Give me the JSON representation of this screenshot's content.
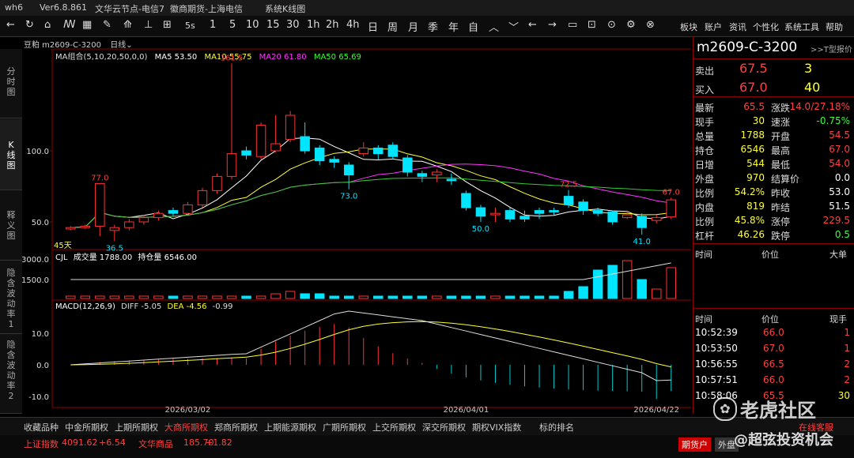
{
  "titlebar": {
    "app": "wh6",
    "version": "Ver6.8.861",
    "node": "文华云节点-电信7",
    "broker": "徽商期货-上海电信",
    "window": "系统K线图"
  },
  "toolbar": {
    "periods": [
      "1",
      "5",
      "10",
      "15",
      "30",
      "1h",
      "2h",
      "4h",
      "日",
      "周",
      "月",
      "季",
      "年",
      "自"
    ],
    "ss_label": "5s",
    "right_menu": [
      "板块",
      "账户",
      "资讯",
      "个性化",
      "系统工具",
      "帮助"
    ]
  },
  "left_tabs": [
    "分时图",
    "K线图",
    "释义图",
    "隐含波动率1",
    "隐含波动率2"
  ],
  "chart_header": {
    "symbol": "豆粕 m2609-C-3200",
    "period": "日线",
    "ma_group": "MA组合(5,10,20,50,0,0)",
    "ma5": "MA5 53.50",
    "ma10": "MA10 55.75",
    "ma20": "MA20 61.80",
    "ma50": "MA50 65.69",
    "vol_label": "CJL",
    "vol_value": "成交量 1788.00",
    "oi_value": "持仓量 6546.00",
    "macd_label": "MACD(12,26,9)",
    "diff": "DIFF -5.05",
    "dea": "DEA -4.56",
    "macd_val": "-0.99",
    "days": "45天"
  },
  "chart_data": {
    "type": "candlestick",
    "y_axis_ticks": [
      "100.0",
      "50.0"
    ],
    "vol_ticks": [
      "3000.0",
      "1500.0"
    ],
    "macd_ticks": [
      "10.0",
      "0.0",
      "-10.0"
    ],
    "x_ticks": [
      "2026/03/02",
      "2026/04/01",
      "2026/04/22"
    ],
    "annotations": [
      "161.5",
      "77.0",
      "36.5",
      "73.0",
      "72.5",
      "50.0",
      "67.0",
      "41.0"
    ],
    "candles": [
      {
        "o": 45,
        "c": 46,
        "h": 47,
        "l": 44,
        "up": true
      },
      {
        "o": 46,
        "c": 47,
        "h": 48,
        "l": 45,
        "up": true
      },
      {
        "o": 47,
        "c": 77,
        "h": 77,
        "l": 40,
        "up": true
      },
      {
        "o": 44,
        "c": 46,
        "h": 48,
        "l": 36.5,
        "up": true
      },
      {
        "o": 46,
        "c": 50,
        "h": 52,
        "l": 44,
        "up": true
      },
      {
        "o": 50,
        "c": 53,
        "h": 55,
        "l": 48,
        "up": true
      },
      {
        "o": 53,
        "c": 56,
        "h": 58,
        "l": 51,
        "up": true
      },
      {
        "o": 58,
        "c": 56,
        "h": 60,
        "l": 54,
        "up": false
      },
      {
        "o": 56,
        "c": 62,
        "h": 64,
        "l": 55,
        "up": true
      },
      {
        "o": 62,
        "c": 72,
        "h": 74,
        "l": 60,
        "up": true
      },
      {
        "o": 72,
        "c": 82,
        "h": 84,
        "l": 70,
        "up": true
      },
      {
        "o": 82,
        "c": 98,
        "h": 161.5,
        "l": 80,
        "up": true
      },
      {
        "o": 100,
        "c": 97,
        "h": 103,
        "l": 94,
        "up": false
      },
      {
        "o": 96,
        "c": 118,
        "h": 120,
        "l": 94,
        "up": true
      },
      {
        "o": 100,
        "c": 105,
        "h": 125,
        "l": 99,
        "up": true
      },
      {
        "o": 108,
        "c": 125,
        "h": 128,
        "l": 106,
        "up": true
      },
      {
        "o": 110,
        "c": 100,
        "h": 120,
        "l": 98,
        "up": false
      },
      {
        "o": 102,
        "c": 93,
        "h": 104,
        "l": 90,
        "up": false
      },
      {
        "o": 94,
        "c": 92,
        "h": 96,
        "l": 88,
        "up": false
      },
      {
        "o": 90,
        "c": 83,
        "h": 92,
        "l": 73,
        "up": false
      },
      {
        "o": 98,
        "c": 102,
        "h": 106,
        "l": 96,
        "up": true
      },
      {
        "o": 102,
        "c": 98,
        "h": 104,
        "l": 94,
        "up": false
      },
      {
        "o": 104,
        "c": 96,
        "h": 106,
        "l": 94,
        "up": false
      },
      {
        "o": 95,
        "c": 85,
        "h": 97,
        "l": 82,
        "up": false
      },
      {
        "o": 84,
        "c": 82,
        "h": 86,
        "l": 78,
        "up": false
      },
      {
        "o": 83,
        "c": 85,
        "h": 87,
        "l": 78,
        "up": true
      },
      {
        "o": 80,
        "c": 79,
        "h": 84,
        "l": 76,
        "up": false
      },
      {
        "o": 70,
        "c": 60,
        "h": 72,
        "l": 58,
        "up": false
      },
      {
        "o": 60,
        "c": 54,
        "h": 62,
        "l": 50,
        "up": false
      },
      {
        "o": 55,
        "c": 56,
        "h": 60,
        "l": 50,
        "up": true
      },
      {
        "o": 58,
        "c": 52,
        "h": 60,
        "l": 50,
        "up": false
      },
      {
        "o": 54,
        "c": 52,
        "h": 58,
        "l": 50,
        "up": false
      },
      {
        "o": 58,
        "c": 56,
        "h": 60,
        "l": 52,
        "up": false
      },
      {
        "o": 58,
        "c": 57,
        "h": 60,
        "l": 55,
        "up": false
      },
      {
        "o": 62,
        "c": 68,
        "h": 72.5,
        "l": 60,
        "up": false
      },
      {
        "o": 64,
        "c": 58,
        "h": 66,
        "l": 55,
        "up": false
      },
      {
        "o": 58,
        "c": 56,
        "h": 60,
        "l": 54,
        "up": false
      },
      {
        "o": 57,
        "c": 50,
        "h": 58,
        "l": 48,
        "up": false
      },
      {
        "o": 53,
        "c": 55,
        "h": 58,
        "l": 52,
        "up": true
      },
      {
        "o": 54,
        "c": 46,
        "h": 56,
        "l": 41,
        "up": false
      },
      {
        "o": 51,
        "c": 53,
        "h": 55,
        "l": 49,
        "up": true
      },
      {
        "o": 53.5,
        "c": 65.5,
        "h": 67,
        "l": 52,
        "up": true
      }
    ],
    "volume": [
      0,
      0,
      0,
      0,
      0,
      0,
      0,
      0,
      0,
      0,
      0,
      0,
      0,
      0,
      0,
      0,
      0,
      0,
      0,
      0,
      0,
      0,
      0,
      0,
      0,
      0,
      0,
      0,
      0,
      0,
      0,
      0,
      0,
      0,
      0,
      0,
      0,
      0,
      0,
      0,
      0,
      0
    ],
    "ylim": [
      35,
      165
    ]
  },
  "quote": {
    "symbol": "m2609-C-3200",
    "t_quote": ">>T型报价",
    "sell_label": "卖出",
    "sell_price": "67.5",
    "sell_qty": "3",
    "buy_label": "买入",
    "buy_price": "67.0",
    "buy_qty": "40",
    "rows": [
      {
        "l1": "最新",
        "v1": "65.5",
        "c1": "red",
        "l2": "涨跌",
        "v2": "14.0/27.18%",
        "c2": "red"
      },
      {
        "l1": "现手",
        "v1": "30",
        "c1": "yellow",
        "l2": "速涨",
        "v2": "-0.75%",
        "c2": "green"
      },
      {
        "l1": "总量",
        "v1": "1788",
        "c1": "yellow",
        "l2": "开盘",
        "v2": "54.5",
        "c2": "red"
      },
      {
        "l1": "持仓",
        "v1": "6546",
        "c1": "yellow",
        "l2": "最高",
        "v2": "67.0",
        "c2": "red"
      },
      {
        "l1": "日增",
        "v1": "544",
        "c1": "yellow",
        "l2": "最低",
        "v2": "54.0",
        "c2": "red"
      },
      {
        "l1": "外盘",
        "v1": "970",
        "c1": "yellow",
        "l2": "结算价",
        "v2": "0.0",
        "c2": "white"
      },
      {
        "l1": "比例",
        "v1": "54.2%",
        "c1": "yellow",
        "l2": "昨收",
        "v2": "53.0",
        "c2": "white"
      },
      {
        "l1": "内盘",
        "v1": "819",
        "c1": "yellow",
        "l2": "昨结",
        "v2": "51.5",
        "c2": "white"
      },
      {
        "l1": "比例",
        "v1": "45.8%",
        "c1": "yellow",
        "l2": "涨停",
        "v2": "229.5",
        "c2": "red"
      },
      {
        "l1": "杠杆",
        "v1": "46.26",
        "c1": "yellow",
        "l2": "跌停",
        "v2": "0.5",
        "c2": "green"
      }
    ],
    "tick_head": [
      "时间",
      "价位",
      "大单"
    ],
    "trade_head": [
      "时间",
      "价位",
      "现手"
    ],
    "trades": [
      {
        "t": "10:52:39",
        "p": "66.0",
        "q": "1"
      },
      {
        "t": "10:53:50",
        "p": "67.0",
        "q": "1"
      },
      {
        "t": "10:56:55",
        "p": "66.5",
        "q": "2"
      },
      {
        "t": "10:57:51",
        "p": "66.0",
        "q": "2"
      },
      {
        "t": "10:58:06",
        "p": "65.5",
        "q": "30"
      }
    ]
  },
  "bottom_tabs": [
    "收藏品种",
    "中金所期权",
    "上期所期权",
    "大商所期权",
    "郑商所期权",
    "上期能源期权",
    "广期所期权",
    "上交所期权",
    "深交所期权",
    "期权VIX指数",
    "标的排名"
  ],
  "active_tab": "大商所期权",
  "status": {
    "idx1_name": "上证指数",
    "idx1_val": "4091.62",
    "idx1_chg": "+6.54",
    "idx2_name": "文华商品",
    "idx2_val": "185.70",
    "idx2_chg": "+1.82",
    "btn1": "期货户",
    "btn2": "外盘",
    "watermark": "老虎社区",
    "wm_sub": "@超弦投资机会",
    "online": "在线客服"
  }
}
